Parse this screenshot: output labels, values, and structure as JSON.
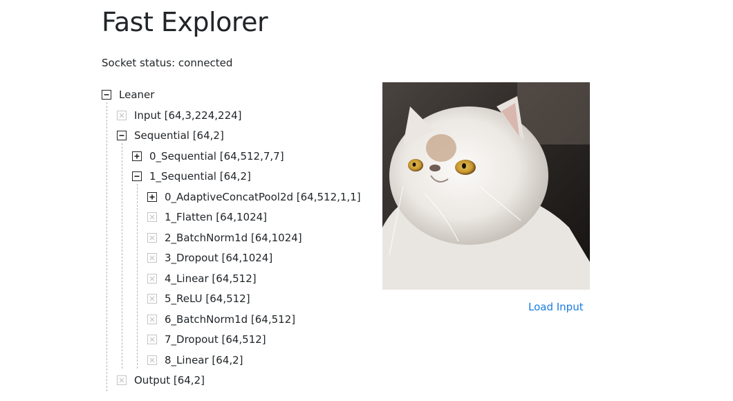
{
  "page": {
    "title": "Fast Explorer",
    "socket_status": "Socket status: connected"
  },
  "tree": {
    "root": "Leaner",
    "input": "Input [64,3,224,224]",
    "sequential": "Sequential [64,2]",
    "seq0": "0_Sequential [64,512,7,7]",
    "seq1": "1_Sequential [64,2]",
    "head": [
      "0_AdaptiveConcatPool2d [64,512,1,1]",
      "1_Flatten [64,1024]",
      "2_BatchNorm1d [64,1024]",
      "3_Dropout [64,1024]",
      "4_Linear [64,512]",
      "5_ReLU [64,512]",
      "6_BatchNorm1d [64,512]",
      "7_Dropout [64,512]",
      "8_Linear [64,2]"
    ],
    "output": "Output [64,2]"
  },
  "actions": {
    "load_input": "Load Input"
  },
  "colors": {
    "link": "#1a7ce0",
    "text": "#212529",
    "tree_line": "#b5b5b5"
  },
  "icons": {
    "expanded": "minus-square-icon",
    "collapsed": "plus-square-icon",
    "leaf": "x-square-icon"
  }
}
